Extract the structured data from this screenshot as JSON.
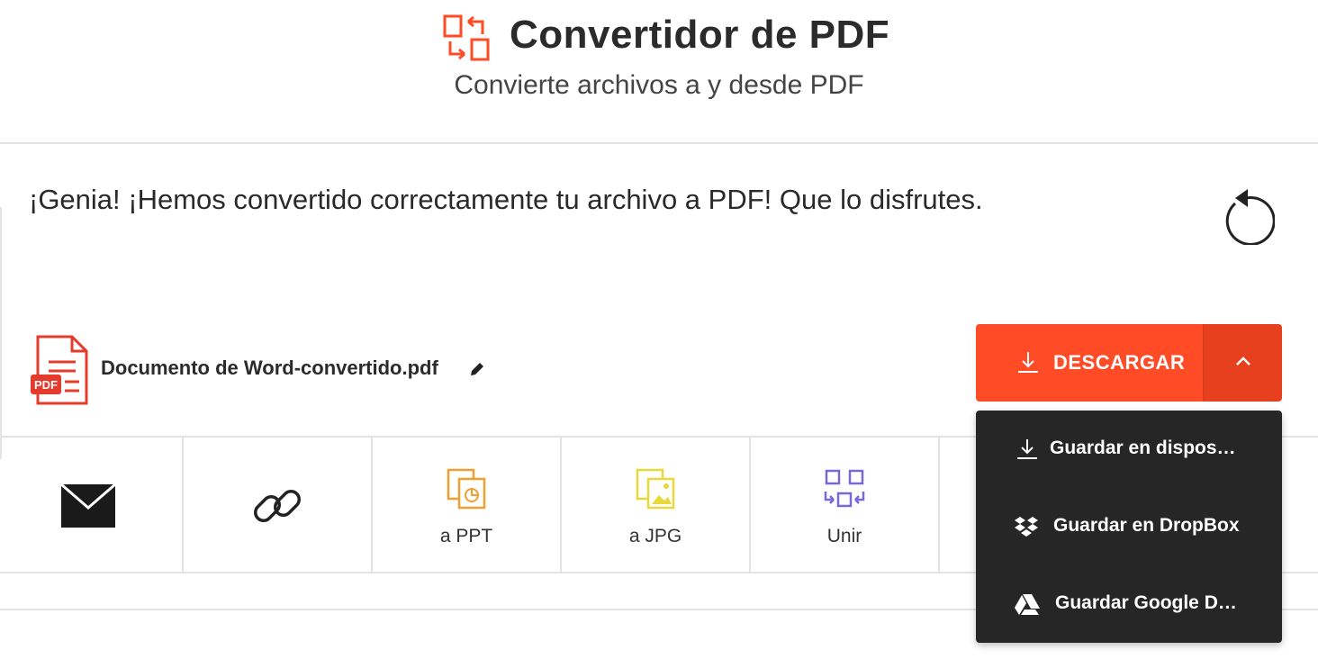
{
  "header": {
    "title": "Convertidor de PDF",
    "subtitle": "Convierte archivos a y desde PDF",
    "logo_icon": "convert-arrows-icon"
  },
  "result": {
    "message": "¡Genia! ¡Hemos convertido correctamente tu archivo a PDF! Que lo disfrutes.",
    "restart_icon": "restart-icon",
    "file": {
      "name": "Documento de Word-convertido.pdf",
      "badge": "PDF",
      "icon": "pdf-file-icon",
      "edit_icon": "pencil-icon"
    },
    "download": {
      "label": "DESCARGAR",
      "icon": "download-icon",
      "toggle_icon": "chevron-up-icon"
    }
  },
  "actions": [
    {
      "label": "",
      "icon": "email-icon"
    },
    {
      "label": "",
      "icon": "link-icon"
    },
    {
      "label": "a PPT",
      "icon": "ppt-icon"
    },
    {
      "label": "a JPG",
      "icon": "jpg-icon"
    },
    {
      "label": "Unir",
      "icon": "merge-icon"
    }
  ],
  "download_menu": [
    {
      "label": "Guardar en dispos…",
      "icon": "download-icon"
    },
    {
      "label": "Guardar en DropBox",
      "icon": "dropbox-icon"
    },
    {
      "label": "Guardar Google D…",
      "icon": "google-drive-icon"
    }
  ],
  "colors": {
    "accent": "#ff4b26",
    "accent_dark": "#e6401f",
    "menu_bg": "#262626",
    "ppt": "#f0a030",
    "jpg": "#e8d83a",
    "merge": "#7b68d8"
  }
}
